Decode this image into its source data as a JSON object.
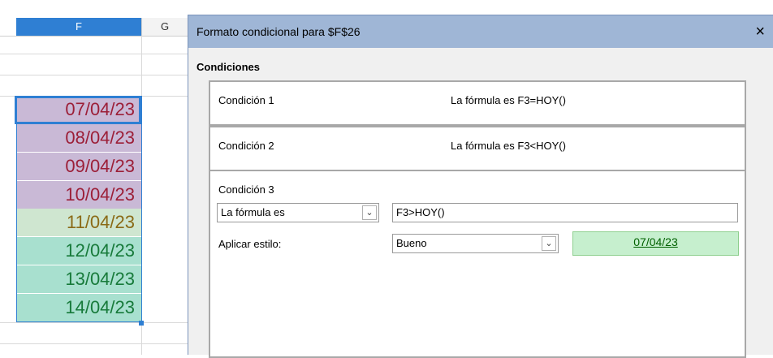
{
  "sheet": {
    "column_f": "F",
    "column_g": "G",
    "cells": [
      {
        "value": "07/04/23",
        "bg": "#c9b9d6",
        "color": "#9c1f38"
      },
      {
        "value": "08/04/23",
        "bg": "#c9b9d6",
        "color": "#9c1f38"
      },
      {
        "value": "09/04/23",
        "bg": "#c9b9d6",
        "color": "#9c1f38"
      },
      {
        "value": "10/04/23",
        "bg": "#c9b9d6",
        "color": "#9c1f38"
      },
      {
        "value": "11/04/23",
        "bg": "#cfe6d0",
        "color": "#8a6a16"
      },
      {
        "value": "12/04/23",
        "bg": "#a8e0cf",
        "color": "#177a3a"
      },
      {
        "value": "13/04/23",
        "bg": "#a8e0cf",
        "color": "#177a3a"
      },
      {
        "value": "14/04/23",
        "bg": "#a8e0cf",
        "color": "#177a3a"
      }
    ]
  },
  "dialog": {
    "title": "Formato condicional para $F$26",
    "close_icon": "×",
    "section": "Condiciones",
    "conditions": [
      {
        "title": "Condición 1",
        "summary": "La fórmula es  F3=HOY()"
      },
      {
        "title": "Condición 2",
        "summary": "La fórmula es  F3<HOY()"
      }
    ],
    "condition3": {
      "title": "Condición 3",
      "type_value": "La fórmula es",
      "formula": "F3>HOY()",
      "apply_label": "Aplicar estilo:",
      "style_value": "Bueno",
      "preview": "07/04/23"
    }
  }
}
